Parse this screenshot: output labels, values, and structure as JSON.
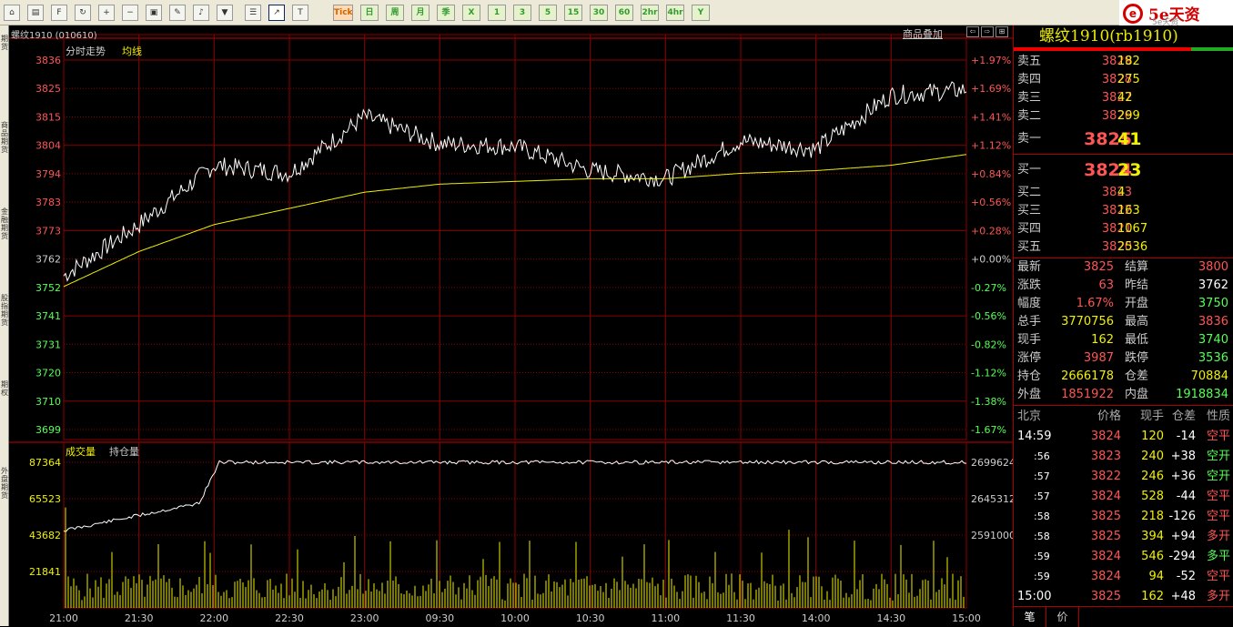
{
  "toolbar": {
    "tools": [
      "home-icon",
      "book-icon",
      "f10-icon",
      "refresh-icon",
      "zoom-in-icon",
      "zoom-out-icon",
      "window-icon",
      "pen-icon",
      "bell-icon",
      "filter-icon",
      "table-icon",
      "trend-icon",
      "tick-icon"
    ],
    "periods": [
      "Tick",
      "日",
      "周",
      "月",
      "季",
      "X",
      "1",
      "3",
      "5",
      "15",
      "30",
      "60",
      "2hr",
      "4hr",
      "Y"
    ],
    "logo": "5e天资",
    "logo_sub": "5e天资"
  },
  "left_tabs": [
    "期货",
    "商品期货",
    "金融期货",
    "股指期货",
    "期权",
    "外盘期货"
  ],
  "chart": {
    "title": "螺纹1910 (010610)",
    "overlay_link": "商品叠加",
    "price_label": "分时走势",
    "avg_label": "均线",
    "vol_label": "成交量",
    "oi_label": "持仓量",
    "price_ticks": [
      "3836",
      "3825",
      "3815",
      "3804",
      "3794",
      "3783",
      "3773",
      "3762",
      "3752",
      "3741",
      "3731",
      "3720",
      "3710",
      "3699"
    ],
    "pct_ticks": [
      "+1.97%",
      "+1.69%",
      "+1.41%",
      "+1.12%",
      "+0.84%",
      "+0.56%",
      "+0.28%",
      "+0.00%",
      "-0.27%",
      "-0.56%",
      "-0.82%",
      "-1.12%",
      "-1.38%",
      "-1.67%"
    ],
    "vol_ticks": [
      "87364",
      "65523",
      "43682",
      "21841"
    ],
    "oi_ticks": [
      "2699624",
      "2645312",
      "2591000"
    ],
    "time_ticks": [
      "21:00",
      "21:30",
      "22:00",
      "22:30",
      "23:00",
      "09:30",
      "10:00",
      "10:30",
      "11:00",
      "11:30",
      "14:00",
      "14:30",
      "15:00"
    ],
    "colors": {
      "price": "#ffffff",
      "avg": "#f0f000",
      "grid": "#8b0000",
      "up": "#ff5555",
      "down": "#55ff55",
      "volume": "#f0f000"
    }
  },
  "chart_data": {
    "type": "line",
    "x": [
      "21:00",
      "21:30",
      "22:00",
      "22:30",
      "23:00",
      "09:30",
      "10:00",
      "10:30",
      "11:00",
      "11:30",
      "14:00",
      "14:30",
      "15:00"
    ],
    "series": [
      {
        "values": [
          3756,
          3775,
          3797,
          3794,
          3815,
          3805,
          3804,
          3795,
          3792,
          3806,
          3803,
          3823,
          3825
        ]
      },
      {
        "values": [
          3752,
          3765,
          3775,
          3781,
          3787,
          3790,
          3791,
          3792,
          3792,
          3794,
          3795,
          3797,
          3801
        ]
      }
    ],
    "ylim": [
      3694,
      3841
    ],
    "prev_settle": 3762
  },
  "panel": {
    "title": "螺纹1910(rb1910)",
    "asks": [
      {
        "l": "卖五",
        "p": "3829",
        "v": "182"
      },
      {
        "l": "卖四",
        "p": "3828",
        "v": "275"
      },
      {
        "l": "卖三",
        "p": "3827",
        "v": "42"
      },
      {
        "l": "卖二",
        "p": "3826",
        "v": "299"
      },
      {
        "l": "卖一",
        "p": "3825",
        "v": "41"
      }
    ],
    "bids": [
      {
        "l": "买一",
        "p": "3824",
        "v": "23"
      },
      {
        "l": "买二",
        "p": "3823",
        "v": "4"
      },
      {
        "l": "买三",
        "p": "3822",
        "v": "163"
      },
      {
        "l": "买四",
        "p": "3821",
        "v": "1067"
      },
      {
        "l": "买五",
        "p": "3820",
        "v": "2536"
      }
    ],
    "stats": [
      {
        "l1": "最新",
        "v1": "3825",
        "l2": "结算",
        "v2": "3800"
      },
      {
        "l1": "涨跌",
        "v1": "63",
        "l2": "昨结",
        "v2": "3762"
      },
      {
        "l1": "幅度",
        "v1": "1.67%",
        "l2": "开盘",
        "v2": "3750"
      },
      {
        "l1": "总手",
        "v1": "3770756",
        "l2": "最高",
        "v2": "3836"
      },
      {
        "l1": "现手",
        "v1": "162",
        "l2": "最低",
        "v2": "3740"
      },
      {
        "l1": "涨停",
        "v1": "3987",
        "l2": "跌停",
        "v2": "3536"
      },
      {
        "l1": "持仓",
        "v1": "2666178",
        "l2": "仓差",
        "v2": "70884"
      },
      {
        "l1": "外盘",
        "v1": "1851922",
        "l2": "内盘",
        "v2": "1918834"
      }
    ],
    "tick_headers": [
      "北京",
      "价格",
      "现手",
      "仓差",
      "性质"
    ],
    "ticks": [
      {
        "t": "14:59",
        "p": "3824",
        "v": "120",
        "d": "-14",
        "n": "空平"
      },
      {
        "t": ":56",
        "p": "3823",
        "v": "240",
        "d": "+38",
        "n": "空开"
      },
      {
        "t": ":57",
        "p": "3822",
        "v": "246",
        "d": "+36",
        "n": "空开"
      },
      {
        "t": ":57",
        "p": "3824",
        "v": "528",
        "d": "-44",
        "n": "空平"
      },
      {
        "t": ":58",
        "p": "3825",
        "v": "218",
        "d": "-126",
        "n": "空平"
      },
      {
        "t": ":58",
        "p": "3825",
        "v": "394",
        "d": "+94",
        "n": "多开"
      },
      {
        "t": ":59",
        "p": "3824",
        "v": "546",
        "d": "-294",
        "n": "多平"
      },
      {
        "t": ":59",
        "p": "3824",
        "v": "94",
        "d": "-52",
        "n": "空平"
      },
      {
        "t": "15:00",
        "p": "3825",
        "v": "162",
        "d": "+48",
        "n": "多开"
      }
    ],
    "bottom_tabs": [
      "笔",
      "价"
    ]
  }
}
